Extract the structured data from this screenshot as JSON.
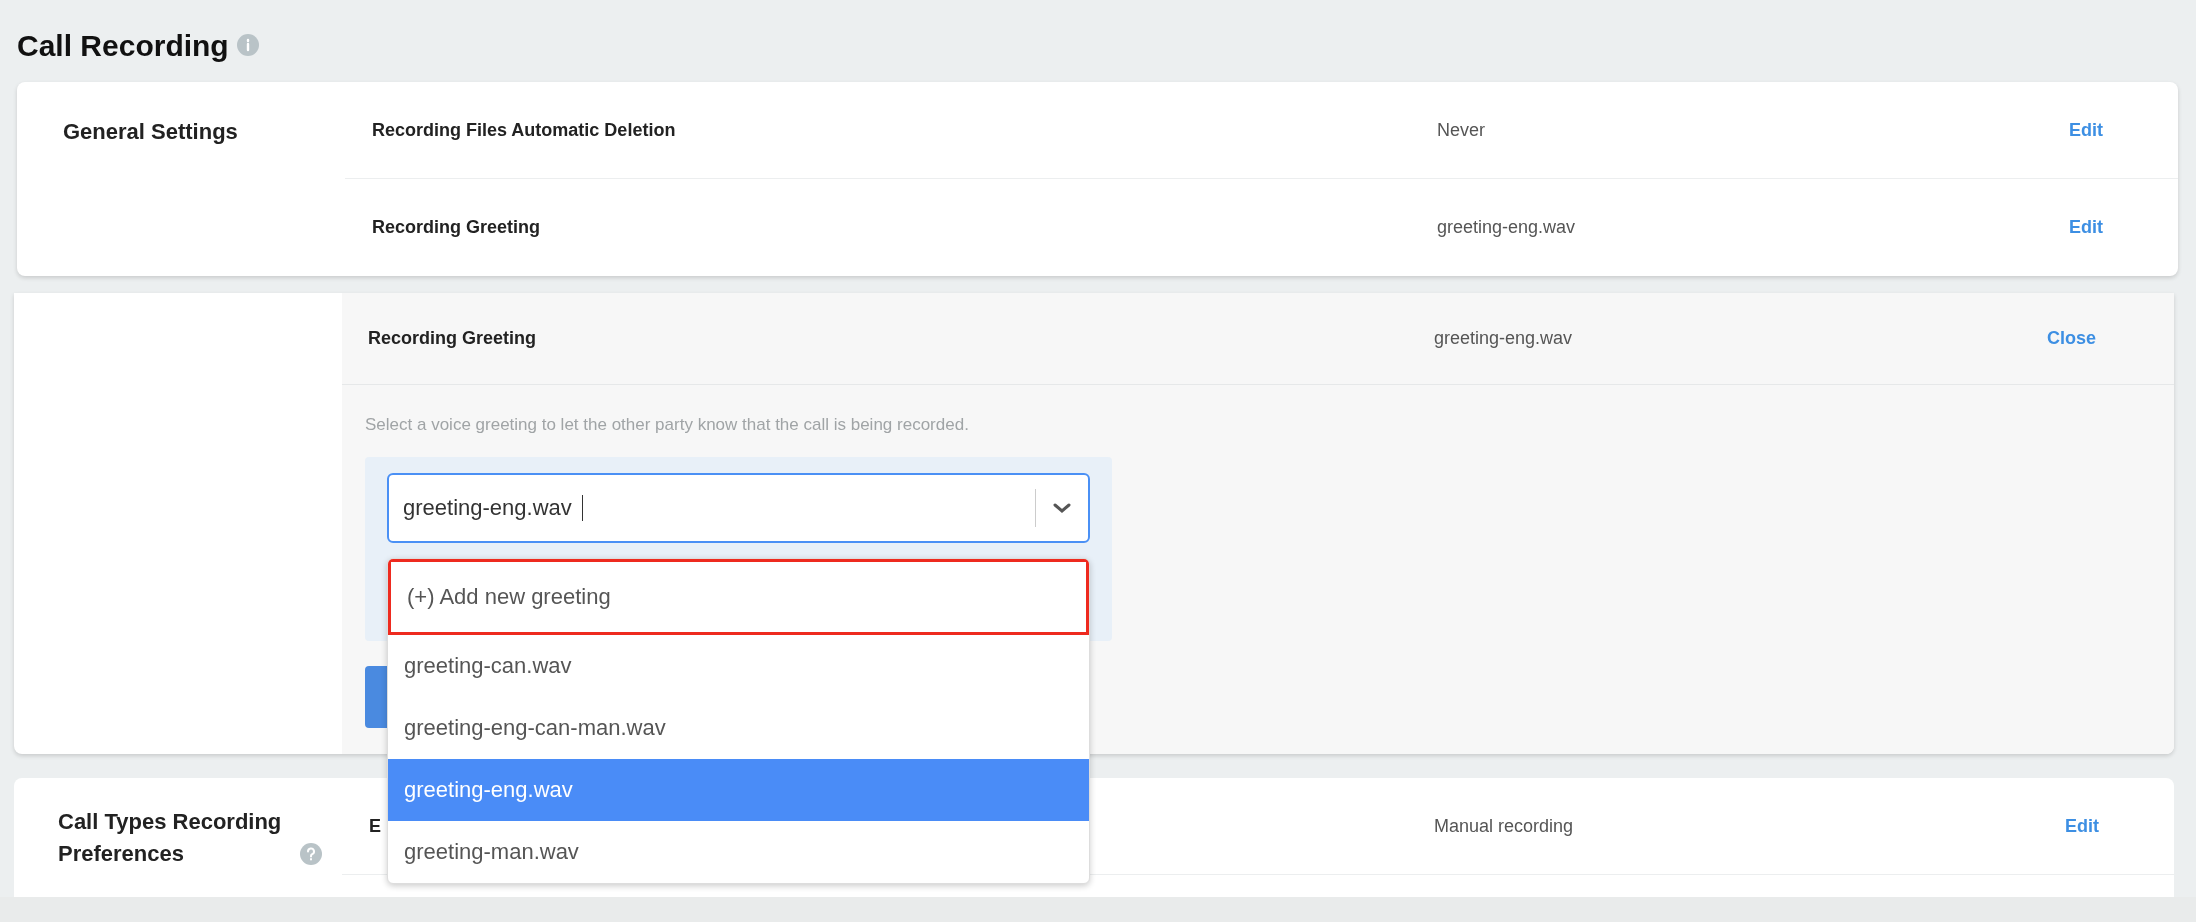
{
  "title": "Call Recording",
  "general_settings": {
    "heading": "General Settings",
    "rows": [
      {
        "label": "Recording Files Automatic Deletion",
        "value": "Never",
        "action": "Edit"
      },
      {
        "label": "Recording Greeting",
        "value": "greeting-eng.wav",
        "action": "Edit"
      }
    ]
  },
  "editor": {
    "label": "Recording Greeting",
    "value": "greeting-eng.wav",
    "action": "Close",
    "description": "Select a voice greeting to let the other party know that the call is being recorded.",
    "select": {
      "value": "greeting-eng.wav",
      "focused": true,
      "expanded": true
    },
    "options": [
      {
        "label": "(+) Add new greeting",
        "outlined": true,
        "selected": false
      },
      {
        "label": "greeting-can.wav",
        "outlined": false,
        "selected": false
      },
      {
        "label": "greeting-eng-can-man.wav",
        "outlined": false,
        "selected": false
      },
      {
        "label": "greeting-eng.wav",
        "outlined": false,
        "selected": true
      },
      {
        "label": "greeting-man.wav",
        "outlined": false,
        "selected": false
      }
    ]
  },
  "call_types": {
    "heading": "Call Types Recording Preferences",
    "rows": [
      {
        "label": "E",
        "value": "Manual recording",
        "action": "Edit"
      }
    ]
  }
}
